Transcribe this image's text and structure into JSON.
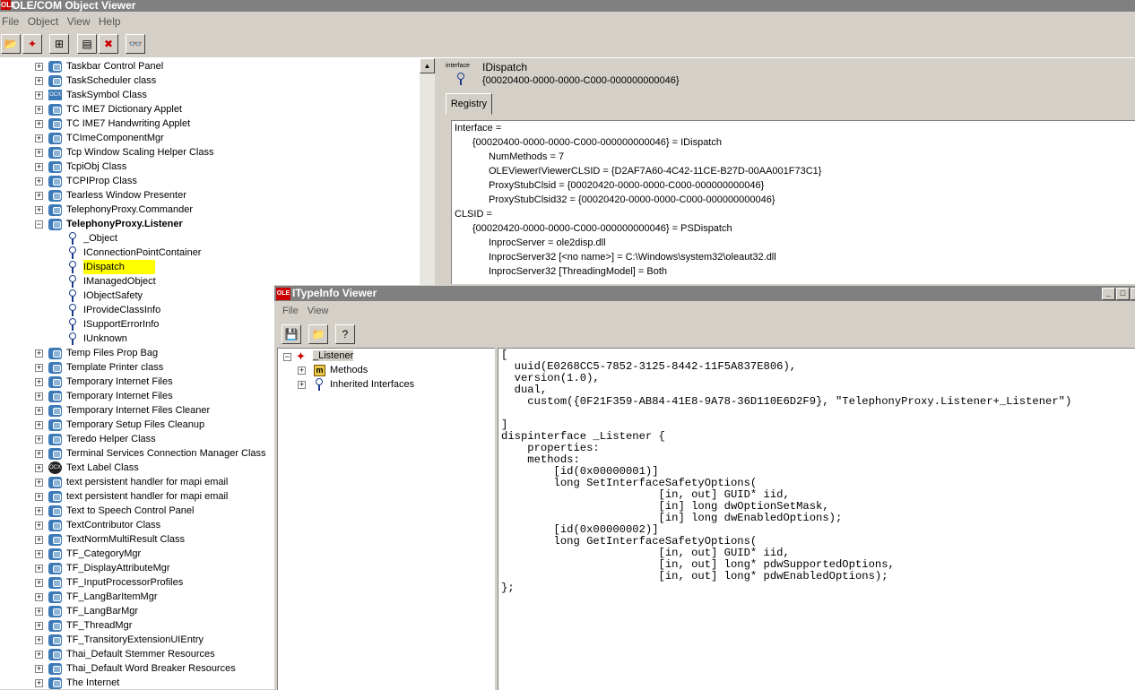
{
  "main_window": {
    "title": "OLE/COM Object Viewer",
    "menu": [
      "File",
      "Object",
      "View",
      "Help"
    ]
  },
  "left_tree": {
    "items": [
      {
        "label": "Taskbar Control Panel",
        "type": "class"
      },
      {
        "label": "TaskScheduler class",
        "type": "class"
      },
      {
        "label": "TaskSymbol Class",
        "type": "ocx"
      },
      {
        "label": "TC IME7 Dictionary Applet",
        "type": "class"
      },
      {
        "label": "TC IME7 Handwriting Applet",
        "type": "class"
      },
      {
        "label": "TCImeComponentMgr",
        "type": "class"
      },
      {
        "label": "Tcp Window Scaling Helper Class",
        "type": "class"
      },
      {
        "label": "TcpiObj Class",
        "type": "class"
      },
      {
        "label": "TCPIProp Class",
        "type": "class"
      },
      {
        "label": "Tearless Window Presenter",
        "type": "class"
      },
      {
        "label": "TelephonyProxy.Commander",
        "type": "class"
      },
      {
        "label": "TelephonyProxy.Listener",
        "type": "class-expanded"
      },
      {
        "label": "_Object",
        "type": "iface"
      },
      {
        "label": "IConnectionPointContainer",
        "type": "iface"
      },
      {
        "label": "IDispatch",
        "type": "iface-selected"
      },
      {
        "label": "IManagedObject",
        "type": "iface"
      },
      {
        "label": "IObjectSafety",
        "type": "iface"
      },
      {
        "label": "IProvideClassInfo",
        "type": "iface"
      },
      {
        "label": "ISupportErrorInfo",
        "type": "iface"
      },
      {
        "label": "IUnknown",
        "type": "iface"
      },
      {
        "label": "Temp Files Prop Bag",
        "type": "class"
      },
      {
        "label": "Template Printer class",
        "type": "class"
      },
      {
        "label": "Temporary Internet Files",
        "type": "class"
      },
      {
        "label": "Temporary Internet Files",
        "type": "class"
      },
      {
        "label": "Temporary Internet Files Cleaner",
        "type": "class"
      },
      {
        "label": "Temporary Setup Files Cleanup",
        "type": "class"
      },
      {
        "label": "Teredo Helper Class",
        "type": "class"
      },
      {
        "label": "Terminal Services Connection Manager Class",
        "type": "class"
      },
      {
        "label": "Text Label Class",
        "type": "ocx-round"
      },
      {
        "label": "text persistent handler for mapi email",
        "type": "class"
      },
      {
        "label": "text persistent handler for mapi email",
        "type": "class"
      },
      {
        "label": "Text to Speech Control Panel",
        "type": "class"
      },
      {
        "label": "TextContributor Class",
        "type": "class"
      },
      {
        "label": "TextNormMultiResult Class",
        "type": "class"
      },
      {
        "label": "TF_CategoryMgr",
        "type": "class"
      },
      {
        "label": "TF_DisplayAttributeMgr",
        "type": "class"
      },
      {
        "label": "TF_InputProcessorProfiles",
        "type": "class"
      },
      {
        "label": "TF_LangBarItemMgr",
        "type": "class"
      },
      {
        "label": "TF_LangBarMgr",
        "type": "class"
      },
      {
        "label": "TF_ThreadMgr",
        "type": "class"
      },
      {
        "label": "TF_TransitoryExtensionUIEntry",
        "type": "class"
      },
      {
        "label": "Thai_Default Stemmer Resources",
        "type": "class"
      },
      {
        "label": "Thai_Default Word Breaker Resources",
        "type": "class"
      },
      {
        "label": "The Internet",
        "type": "class"
      }
    ]
  },
  "right_panel": {
    "tag": "interface",
    "name": "IDispatch",
    "guid": "{00020400-0000-0000-C000-000000000046}",
    "tab": "Registry",
    "lines": [
      {
        "indent": 0,
        "text": "Interface ="
      },
      {
        "indent": 1,
        "text": "{00020400-0000-0000-C000-000000000046} = IDispatch"
      },
      {
        "indent": 2,
        "text": "NumMethods = 7"
      },
      {
        "indent": 2,
        "text": "OLEViewerIViewerCLSID = {D2AF7A60-4C42-11CE-B27D-00AA001F73C1}"
      },
      {
        "indent": 2,
        "text": "ProxyStubClsid = {00020420-0000-0000-C000-000000000046}"
      },
      {
        "indent": 2,
        "text": "ProxyStubClsid32 = {00020420-0000-0000-C000-000000000046}"
      },
      {
        "indent": 0,
        "text": "CLSID ="
      },
      {
        "indent": 1,
        "text": "{00020420-0000-0000-C000-000000000046} = PSDispatch"
      },
      {
        "indent": 2,
        "text": "InprocServer = ole2disp.dll"
      },
      {
        "indent": 2,
        "text": "InprocServer32 [<no name>] = C:\\Windows\\system32\\oleaut32.dll"
      },
      {
        "indent": 2,
        "text": "InprocServer32 [ThreadingModel] = Both"
      }
    ]
  },
  "typeinfo_window": {
    "title": "ITypeInfo Viewer",
    "menu": [
      "File",
      "View"
    ],
    "tree": {
      "root": "_Listener",
      "children": [
        "Methods",
        "Inherited Interfaces"
      ]
    },
    "code": "[\n  uuid(E0268CC5-7852-3125-8442-11F5A837E806),\n  version(1.0),\n  dual,\n    custom({0F21F359-AB84-41E8-9A78-36D110E6D2F9}, \"TelephonyProxy.Listener+_Listener\")\n\n]\ndispinterface _Listener {\n    properties:\n    methods:\n        [id(0x00000001)]\n        long SetInterfaceSafetyOptions(\n                        [in, out] GUID* iid,\n                        [in] long dwOptionSetMask,\n                        [in] long dwEnabledOptions);\n        [id(0x00000002)]\n        long GetInterfaceSafetyOptions(\n                        [in, out] GUID* iid,\n                        [in, out] long* pdwSupportedOptions,\n                        [in, out] long* pdwEnabledOptions);\n};"
  },
  "colors": {
    "title_bar": "#808080",
    "selection_highlight": "#ffff00",
    "chrome": "#d4d0c8"
  }
}
